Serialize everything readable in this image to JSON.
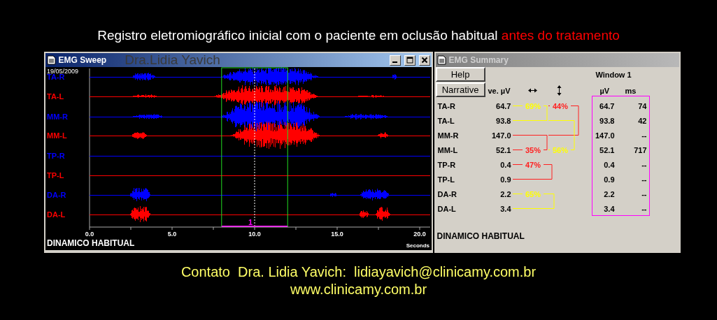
{
  "heading": {
    "text": "Registro eletromiográfico inicial com o paciente em oclusão habitual ",
    "highlight": "antes do tratamento"
  },
  "sweep_window": {
    "title": "EMG Sweep",
    "author_overlay": "Dra.Lidia Yavich",
    "date": "19/05/2009",
    "channels": [
      {
        "name": "TA-R",
        "color": "#0000ff"
      },
      {
        "name": "TA-L",
        "color": "#ff0000"
      },
      {
        "name": "MM-R",
        "color": "#0000ff"
      },
      {
        "name": "MM-L",
        "color": "#ff0000"
      },
      {
        "name": "TP-R",
        "color": "#0000ff"
      },
      {
        "name": "TP-L",
        "color": "#ff0000"
      },
      {
        "name": "DA-R",
        "color": "#0000ff"
      },
      {
        "name": "DA-L",
        "color": "#ff0000"
      }
    ],
    "x_ticks": [
      "0.0",
      "5.0",
      "10.0",
      "15.0",
      "20.0"
    ],
    "x_unit": "Seconds",
    "window_marker": "1",
    "recording_label": "DINAMICO HABITUAL"
  },
  "summary_window": {
    "title": "EMG Summary",
    "buttons": [
      "Help",
      "Narrative"
    ],
    "window_heading": "Window 1",
    "columns": {
      "average": "ve. µV",
      "window_uv": "µV",
      "window_ms": "ms"
    },
    "rows": [
      {
        "name": "TA-R",
        "average": "64.7",
        "window_uv": "64.7",
        "window_ms": "74"
      },
      {
        "name": "TA-L",
        "average": "93.8",
        "window_uv": "93.8",
        "window_ms": "42"
      },
      {
        "name": "MM-R",
        "average": "147.0",
        "window_uv": "147.0",
        "window_ms": "--"
      },
      {
        "name": "MM-L",
        "average": "52.1",
        "window_uv": "52.1",
        "window_ms": "717"
      },
      {
        "name": "TP-R",
        "average": "0.4",
        "window_uv": "0.4",
        "window_ms": "--"
      },
      {
        "name": "TP-L",
        "average": "0.9",
        "window_uv": "0.9",
        "window_ms": "--"
      },
      {
        "name": "DA-R",
        "average": "2.2",
        "window_uv": "2.2",
        "window_ms": "--"
      },
      {
        "name": "DA-L",
        "average": "3.4",
        "window_uv": "3.4",
        "window_ms": "--"
      }
    ],
    "comparisons": [
      {
        "label": "69%",
        "color": "#ffff00"
      },
      {
        "label": "44%",
        "color": "#ff2020"
      },
      {
        "label": "35%",
        "color": "#ff2020"
      },
      {
        "label": "56%",
        "color": "#ffff00"
      },
      {
        "label": "47%",
        "color": "#ff2020"
      },
      {
        "label": "65%",
        "color": "#ffff00"
      }
    ],
    "recording_label": "DINAMICO HABITUAL"
  },
  "footer": {
    "contact": "Contato  Dra. Lidia Yavich:  lidiayavich@clinicamy.com.br",
    "website": "www.clinicamy.com.br"
  }
}
